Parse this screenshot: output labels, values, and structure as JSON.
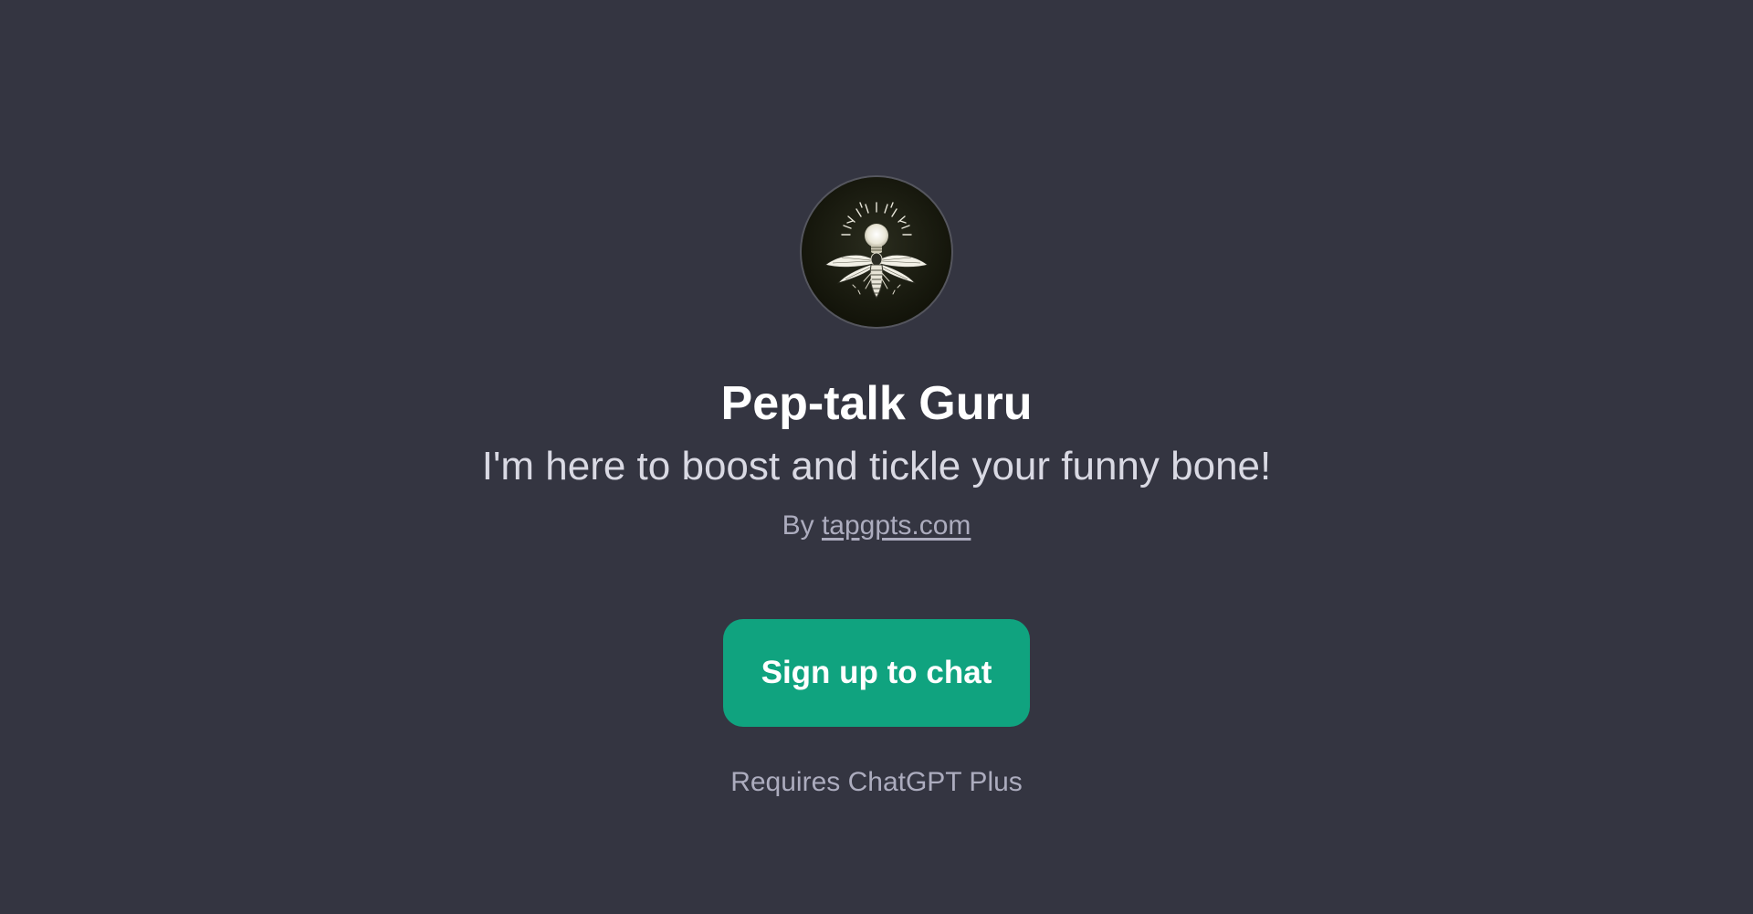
{
  "gpt": {
    "avatar_icon": "firefly-lightbulb-icon",
    "name": "Pep-talk Guru",
    "description": "I'm here to boost and tickle your funny bone!",
    "by_prefix": "By",
    "author_link": "tapgpts.com"
  },
  "actions": {
    "signup_label": "Sign up to chat"
  },
  "footer": {
    "requirement": "Requires ChatGPT Plus"
  },
  "colors": {
    "background": "#343541",
    "button": "#10a37f",
    "title": "#ffffff",
    "subtitle": "#d9d9e3",
    "muted": "#acacbe"
  }
}
